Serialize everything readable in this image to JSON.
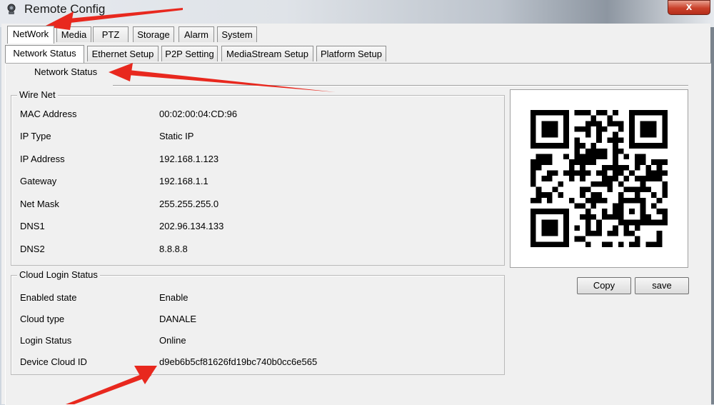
{
  "window": {
    "title": "Remote Config",
    "close_glyph": "x"
  },
  "tabs_main": [
    "NetWork",
    "Media",
    "PTZ",
    "Storage",
    "Alarm",
    "System"
  ],
  "tabs_sub": [
    "Network Status",
    "Ethernet Setup",
    "P2P Setting",
    "MediaStream Setup",
    "Platform Setup"
  ],
  "section_title": "Network Status",
  "wire_net": {
    "title": "Wire Net",
    "fields": [
      {
        "label": "MAC Address",
        "value": "00:02:00:04:CD:96"
      },
      {
        "label": "IP Type",
        "value": "Static IP"
      },
      {
        "label": "IP Address",
        "value": "192.168.1.123"
      },
      {
        "label": "Gateway",
        "value": "192.168.1.1"
      },
      {
        "label": "Net Mask",
        "value": "255.255.255.0"
      },
      {
        "label": "DNS1",
        "value": "202.96.134.133"
      },
      {
        "label": "DNS2",
        "value": "8.8.8.8"
      }
    ]
  },
  "cloud": {
    "title": "Cloud Login Status",
    "fields": [
      {
        "label": "Enabled state",
        "value": "Enable"
      },
      {
        "label": "Cloud type",
        "value": "DANALE"
      },
      {
        "label": "Login Status",
        "value": "Online"
      },
      {
        "label": "Device Cloud ID",
        "value": "d9eb6b5cf81626fd19bc740b0cc6e565"
      }
    ]
  },
  "buttons": {
    "copy": "Copy",
    "save": "save"
  },
  "icons": {
    "app": "camera-icon",
    "qr": "qr-code-icon",
    "annotation": "red-arrow-icon"
  },
  "colors": {
    "annotation_arrow": "#e8281e",
    "close_button": "#c9402a"
  }
}
